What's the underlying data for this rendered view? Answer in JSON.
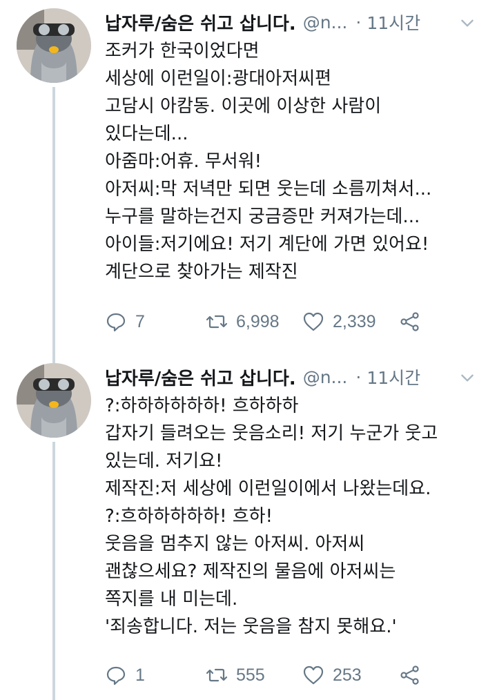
{
  "tweets": [
    {
      "display_name": "납자루/숨은 쉬고 삽니다.",
      "handle": "@n...",
      "separator": "·",
      "time": "11시간",
      "lines": [
        "조커가 한국이었다면",
        "세상에 이런일이:광대아저씨편",
        "고담시 아캄동. 이곳에 이상한 사람이",
        "있다는데...",
        "아줌마:어휴. 무서워!",
        "아저씨:막 저녁만 되면 웃는데 소름끼쳐서...",
        "누구를 말하는건지 궁금증만 커져가는데...",
        "아이들:저기에요! 저기 계단에 가면 있어요!",
        "계단으로 찾아가는 제작진"
      ],
      "replies": "7",
      "retweets": "6,998",
      "likes": "2,339"
    },
    {
      "display_name": "납자루/숨은 쉬고 삽니다.",
      "handle": "@n...",
      "separator": "·",
      "time": "11시간",
      "lines": [
        "?:하하하하하하! 흐하하하",
        "갑자기 들려오는 웃음소리! 저기 누군가 웃고",
        "있는데. 저기요!",
        "제작진:저 세상에 이런일이에서 나왔는데요.",
        "?:흐하하하하하! 흐하!",
        "웃음을 멈추지 않는 아저씨. 아저씨",
        "괜찮으세요? 제작진의 물음에 아저씨는",
        "쪽지를 내 미는데.",
        "'죄송합니다. 저는 웃음을 참지 못해요.'"
      ],
      "replies": "1",
      "retweets": "555",
      "likes": "253"
    }
  ],
  "icons": {
    "reply": "reply-icon",
    "retweet": "retweet-icon",
    "like": "heart-icon",
    "share": "share-icon",
    "menu": "chevron-down-icon"
  },
  "colors": {
    "text": "#14171a",
    "secondary": "#657786",
    "thread_line": "#ccd6dd"
  }
}
